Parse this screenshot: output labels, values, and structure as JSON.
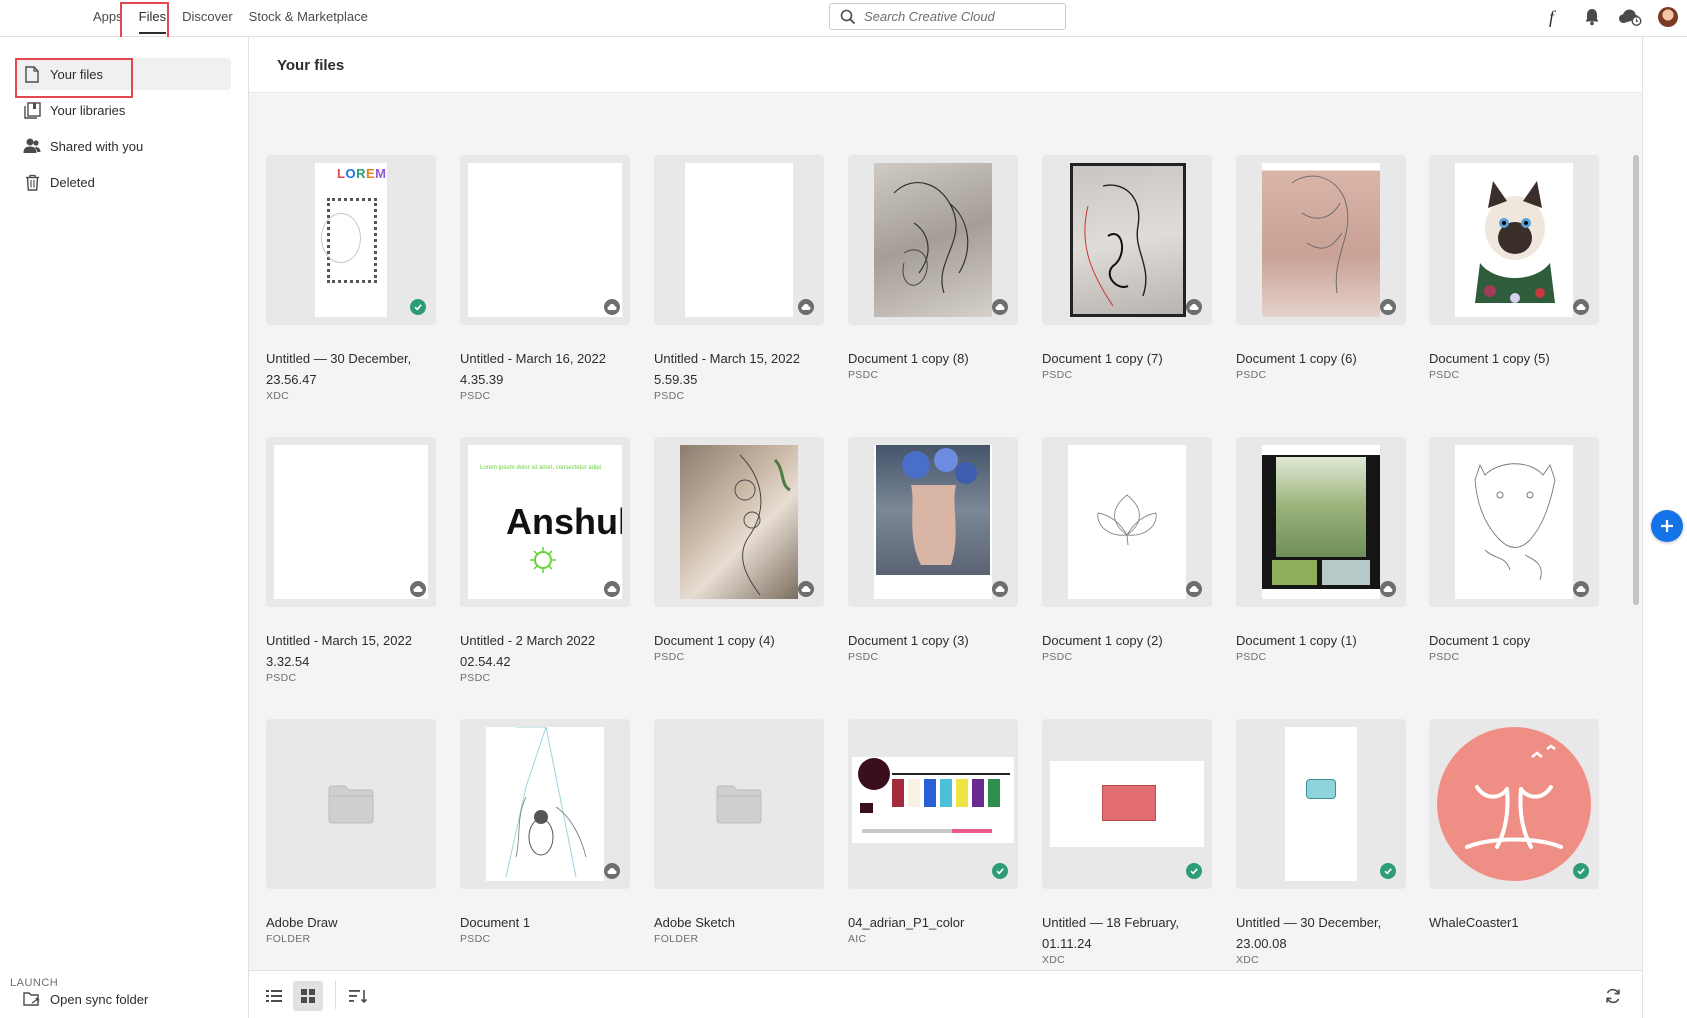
{
  "topnav": {
    "items": [
      "Apps",
      "Files",
      "Discover",
      "Stock & Marketplace"
    ],
    "active": "Files"
  },
  "search": {
    "placeholder": "Search Creative Cloud"
  },
  "top_icons": [
    "fonts-icon",
    "bell-icon",
    "cloud-sync-icon",
    "avatar"
  ],
  "sidebar": {
    "items": [
      {
        "label": "Your files",
        "icon": "file-icon"
      },
      {
        "label": "Your libraries",
        "icon": "library-icon"
      },
      {
        "label": "Shared with you",
        "icon": "people-icon"
      },
      {
        "label": "Deleted",
        "icon": "trash-icon"
      }
    ],
    "launch_label": "LAUNCH",
    "open_sync": "Open sync folder"
  },
  "main": {
    "title": "Your files"
  },
  "files": [
    {
      "name": "Untitled — 30 December, 23.56.47",
      "type": "XDC",
      "status": "synced"
    },
    {
      "name": "Untitled - March 16, 2022 4.35.39",
      "type": "PSDC",
      "status": "cloud"
    },
    {
      "name": "Untitled - March 15, 2022 5.59.35",
      "type": "PSDC",
      "status": "cloud"
    },
    {
      "name": "Document 1 copy (8)",
      "type": "PSDC",
      "status": "cloud"
    },
    {
      "name": "Document 1 copy (7)",
      "type": "PSDC",
      "status": "cloud"
    },
    {
      "name": "Document 1 copy (6)",
      "type": "PSDC",
      "status": "cloud"
    },
    {
      "name": "Document 1 copy (5)",
      "type": "PSDC",
      "status": "cloud"
    },
    {
      "name": "Untitled - March 15, 2022 3.32.54",
      "type": "PSDC",
      "status": "cloud"
    },
    {
      "name": "Untitled - 2 March 2022 02.54.42",
      "type": "PSDC",
      "status": "cloud"
    },
    {
      "name": "Document 1 copy (4)",
      "type": "PSDC",
      "status": "cloud"
    },
    {
      "name": "Document 1 copy (3)",
      "type": "PSDC",
      "status": "cloud"
    },
    {
      "name": "Document 1 copy (2)",
      "type": "PSDC",
      "status": "cloud"
    },
    {
      "name": "Document 1 copy (1)",
      "type": "PSDC",
      "status": "cloud"
    },
    {
      "name": "Document 1 copy",
      "type": "PSDC",
      "status": "cloud"
    },
    {
      "name": "Adobe Draw",
      "type": "FOLDER",
      "status": "none"
    },
    {
      "name": "Document 1",
      "type": "PSDC",
      "status": "cloud"
    },
    {
      "name": "Adobe Sketch",
      "type": "FOLDER",
      "status": "none"
    },
    {
      "name": "04_adrian_P1_color",
      "type": "AIC",
      "status": "synced"
    },
    {
      "name": "Untitled — 18 February, 01.11.24",
      "type": "XDC",
      "status": "synced"
    },
    {
      "name": "Untitled — 30 December, 23.00.08",
      "type": "XDC",
      "status": "synced"
    },
    {
      "name": "WhaleCoaster1",
      "type": "",
      "status": "synced"
    }
  ],
  "thumb_text": {
    "lorem": "LOREM",
    "anshul": "Anshul",
    "anshul_sub": "Lorem ipsum dolor sit amet, consectetur adipi"
  },
  "colors": {
    "accent": "#1473e6",
    "synced": "#2d9d78",
    "highlight": "#e34850",
    "whale": "#ef8e84"
  },
  "bottom": {
    "view_list": "list-view-icon",
    "view_grid": "grid-view-icon",
    "sort": "sort-icon",
    "refresh": "refresh-icon"
  }
}
